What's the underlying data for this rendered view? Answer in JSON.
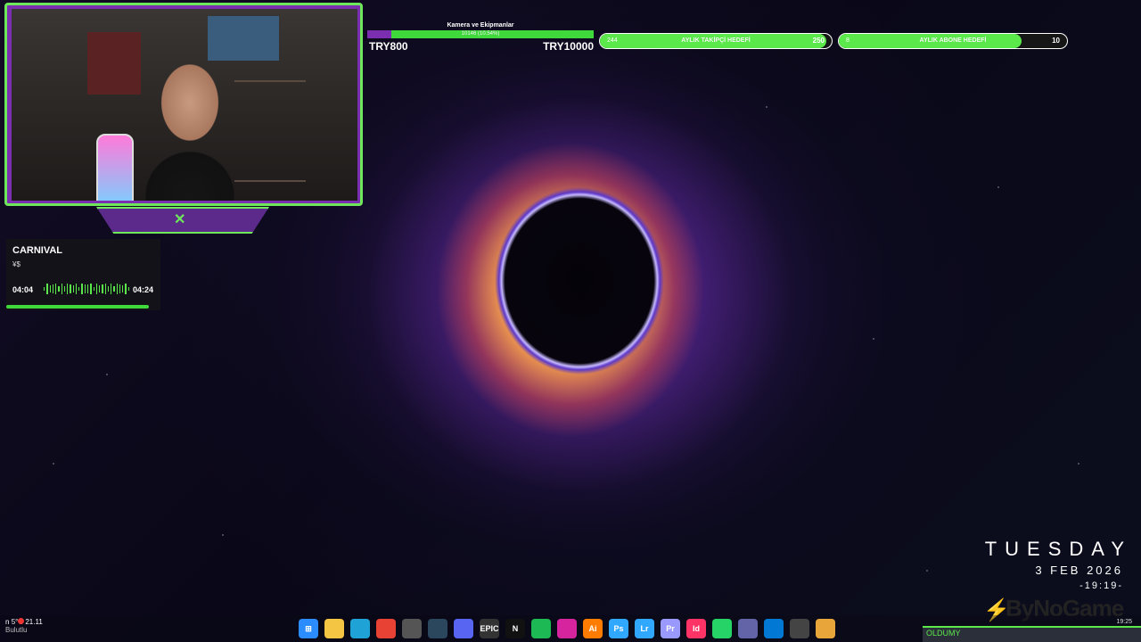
{
  "stream": {
    "now_playing": {
      "title": "CARNIVAL",
      "artist": "¥$",
      "elapsed": "04:04",
      "duration": "04:24",
      "progress": 0.925
    },
    "donation_goal": {
      "label": "Kamera ve Ekipmanlar",
      "bar_text": "10146 (10.54%)",
      "min": "TRY800",
      "max": "TRY10000",
      "progress": 0.1054
    },
    "follower_goal": {
      "label": "AYLIK TAKİPÇİ HEDEFİ",
      "current": "244",
      "target": "250",
      "progress": 0.976
    },
    "subscriber_goal": {
      "label": "AYLIK ABONE HEDEFİ",
      "current": "8",
      "target": "10",
      "progress": 0.8
    },
    "bottom_ticker": "OLDUMY"
  },
  "clock_widget": {
    "day": "TUESDAY",
    "date": "3 FEB 2026",
    "time": "-19:19-"
  },
  "brand": {
    "text": "ByNoGame"
  },
  "taskbar": {
    "weather_temp": "5°C",
    "weather_desc": "Bulutlu",
    "left_text": "n",
    "left_time": "21.11",
    "tray_time": "19:25",
    "icons": [
      {
        "name": "windows-start-icon",
        "label": "⊞",
        "color": "#2b8cff"
      },
      {
        "name": "file-explorer-icon",
        "label": "",
        "color": "#f4c542"
      },
      {
        "name": "edge-icon",
        "label": "",
        "color": "#1fa3d6"
      },
      {
        "name": "chrome-icon",
        "label": "",
        "color": "#e84235"
      },
      {
        "name": "store-icon",
        "label": "",
        "color": "#555"
      },
      {
        "name": "steam-icon",
        "label": "",
        "color": "#2a475e"
      },
      {
        "name": "discord-icon",
        "label": "",
        "color": "#5865f2"
      },
      {
        "name": "epic-games-icon",
        "label": "EPIC",
        "color": "#333"
      },
      {
        "name": "netflix-icon",
        "label": "N",
        "color": "#111"
      },
      {
        "name": "spotify-icon",
        "label": "",
        "color": "#1db954"
      },
      {
        "name": "instagram-icon",
        "label": "",
        "color": "#d6249f"
      },
      {
        "name": "illustrator-icon",
        "label": "Ai",
        "color": "#ff7c00"
      },
      {
        "name": "photoshop-icon",
        "label": "Ps",
        "color": "#31a8ff"
      },
      {
        "name": "lightroom-icon",
        "label": "Lr",
        "color": "#31a8ff"
      },
      {
        "name": "premiere-icon",
        "label": "Pr",
        "color": "#9999ff"
      },
      {
        "name": "indesign-icon",
        "label": "Id",
        "color": "#ff3366"
      },
      {
        "name": "whatsapp-icon",
        "label": "",
        "color": "#25d366"
      },
      {
        "name": "teams-icon",
        "label": "",
        "color": "#6264a7"
      },
      {
        "name": "mail-icon",
        "label": "",
        "color": "#0078d4"
      },
      {
        "name": "obs-icon",
        "label": "",
        "color": "#444"
      },
      {
        "name": "chrome-canary-icon",
        "label": "",
        "color": "#e8a63a"
      }
    ]
  },
  "colors": {
    "accent_green": "#5be84a",
    "accent_purple": "#7b2fb0"
  }
}
